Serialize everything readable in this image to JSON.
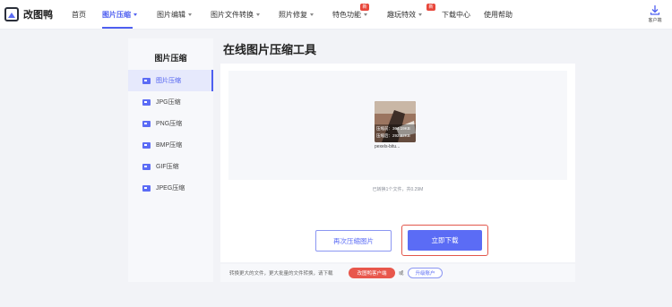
{
  "app": {
    "name": "改图鸭"
  },
  "nav": {
    "items": [
      {
        "label": "首页"
      },
      {
        "label": "图片压缩"
      },
      {
        "label": "图片编辑"
      },
      {
        "label": "图片文件转换"
      },
      {
        "label": "照片修复"
      },
      {
        "label": "特色功能"
      },
      {
        "label": "趣玩特效"
      },
      {
        "label": "下载中心"
      },
      {
        "label": "使用帮助"
      }
    ],
    "badge_new": "新",
    "client_download": "客户端"
  },
  "sidebar": {
    "title": "图片压缩",
    "items": [
      {
        "label": "图片压缩"
      },
      {
        "label": "JPG压缩"
      },
      {
        "label": "PNG压缩"
      },
      {
        "label": "BMP压缩"
      },
      {
        "label": "GIF压缩"
      },
      {
        "label": "JPEG压缩"
      }
    ]
  },
  "main": {
    "title": "在线图片压缩工具",
    "file": {
      "before_label": "压缩前：364.19KB",
      "after_label": "压缩后：292.52KB",
      "name": "pexels-bitu..."
    },
    "summary": "已转换1个文件，共0.29M",
    "compress_again": "再次压缩图片",
    "download_now": "立即下载"
  },
  "bottom": {
    "text": "转换更大的文件，更大批量的文件转换，请下载",
    "client_button": "改图鸭客户端",
    "or": "或",
    "upgrade_button": "升级账户"
  },
  "colors": {
    "accent": "#5b6cf5",
    "nav_active": "#4e5ff0",
    "highlight": "#e2574c",
    "badge": "#e8473b"
  }
}
